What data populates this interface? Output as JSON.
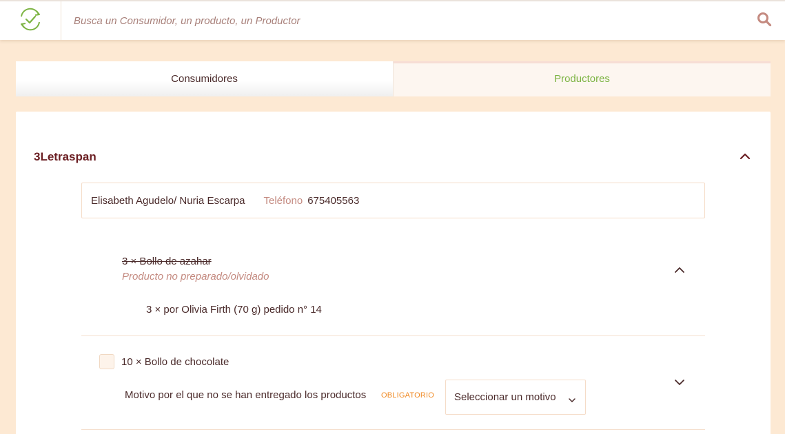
{
  "search": {
    "placeholder": "Busca un Consumidor, un producto, un Productor"
  },
  "tabs": [
    {
      "label": "Consumidores",
      "active": true
    },
    {
      "label": "Productores",
      "active": false
    }
  ],
  "producer": {
    "name": "3Letraspan",
    "contact_name": "Elisabeth Agudelo/ Nuria Escarpa",
    "phone_label": "Teléfono",
    "phone": "675405563"
  },
  "items": [
    {
      "title": "3 × Bollo de azahar",
      "reason": "Producto no preparado/olvidado",
      "detail": "3 × por Olivia Firth (70 g) pedido n° 14"
    },
    {
      "title": "10 × Bollo de chocolate",
      "motivo_label": "Motivo por el que no se han entregado los productos",
      "required_tag": "OBLIGATORIO",
      "select_value": "Seleccionar un motivo"
    }
  ],
  "colors": {
    "background": "#fde9d3",
    "brand_dark": "#6b1f23",
    "accent_green": "#7cb342",
    "required_orange": "#f08a24",
    "muted_pink": "#c48a80"
  },
  "icons": {
    "logo": "recycle-check-icon",
    "search": "search-icon",
    "collapse": "chevron-up-icon",
    "expand": "chevron-down-icon"
  }
}
